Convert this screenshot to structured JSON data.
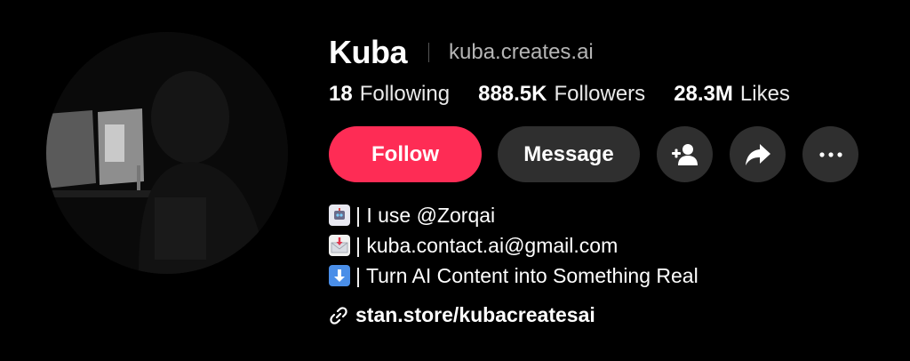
{
  "profile": {
    "name": "Kuba",
    "separator": "|",
    "handle": "kuba.creates.ai"
  },
  "stats": {
    "following_count": "18",
    "following_label": "Following",
    "followers_count": "888.5K",
    "followers_label": "Followers",
    "likes_count": "28.3M",
    "likes_label": "Likes"
  },
  "actions": {
    "follow_label": "Follow",
    "message_label": "Message",
    "add_friend_icon": "add-person-icon",
    "share_icon": "share-arrow-icon",
    "more_icon": "more-dots-icon"
  },
  "bio": {
    "line1_emoji": "robot-emoji",
    "line1_text": "| I use @Zorqai",
    "line2_emoji": "envelope-arrow-emoji",
    "line2_text": "| kuba.contact.ai@gmail.com",
    "line3_emoji": "down-arrow-emoji",
    "line3_text": "| Turn AI Content into Something Real"
  },
  "link": {
    "icon": "link-icon",
    "text": "stan.store/kubacreatesai"
  },
  "colors": {
    "background": "#000000",
    "follow_button": "#fe2c55",
    "secondary_button": "#2f2f2f",
    "handle_text": "#b5b5b5"
  }
}
